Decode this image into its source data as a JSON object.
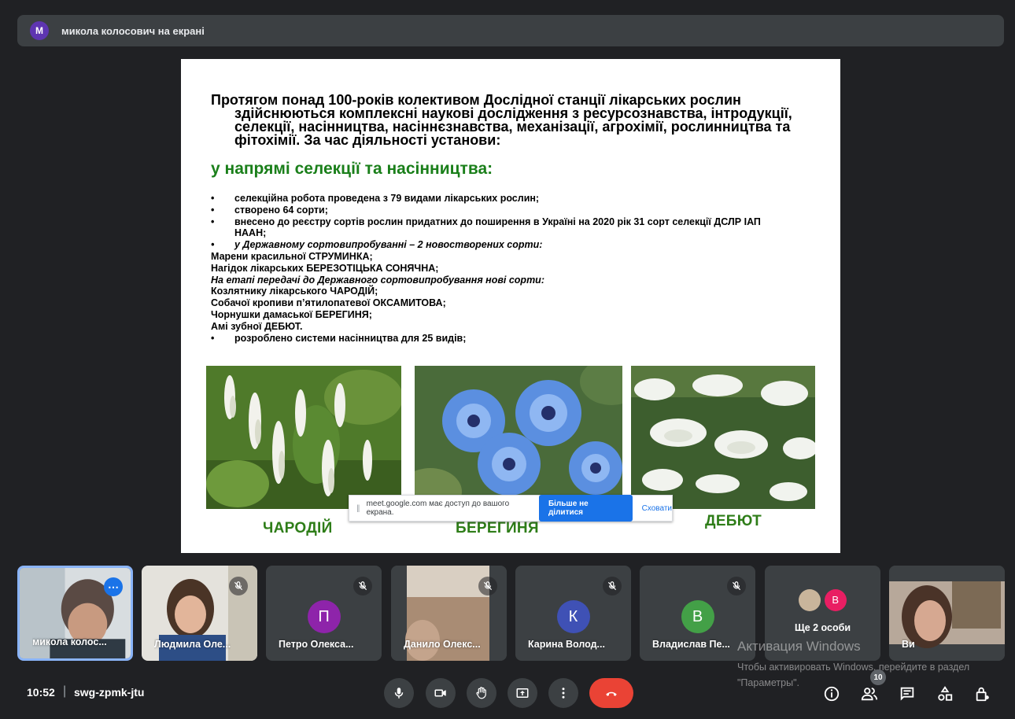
{
  "banner": {
    "avatar_letter": "М",
    "text": "микола колосович на екрані"
  },
  "slide": {
    "intro_line1": "Протягом понад 100-років колективом Дослідної станції лікарських рослин",
    "intro_rest": "здійснюються комплексні наукові дослідження з ресурсознавства, інтродукції, селекції, насінництва, насіннєзнавства, механізації, агрохімії, рослинництва та фітохімії. За час діяльності установи:",
    "heading": "у напрямі селекції та насінництва:",
    "lines": [
      "селекційна робота проведена з 79 видами лікарських рослин;",
      "створено 64 сорти;",
      "внесено до реєстру сортів рослин придатних до поширення в Україні на 2020 рік 31 сорт селекції ДСЛР ІАП НААН;",
      "у Державному сортовипробуванні – 2 новостворених сорти:",
      "Марени красильної СТРУМИНКА;",
      "Нагідок лікарських БЕРЕЗОТІЦЬКА СОНЯЧНА;",
      "На етапі передачі до Державного сортовипробування нові сорти:",
      "Козлятнику лікарського ЧАРОДІЙ;",
      "Собачої кропиви п’ятилопатевої ОКСАМИТОВА;",
      "Чорнушки дамаської БЕРЕГИНЯ;",
      "Амі зубної ДЕБЮТ.",
      "розроблено системи насінництва для 25 видів;"
    ],
    "captions": [
      "ЧАРОДІЙ",
      "БЕРЕГИНЯ",
      "ДЕБЮТ"
    ]
  },
  "sharebar": {
    "message": "meet.google.com має доступ до вашого екрана.",
    "stop_label": "Більше не ділитися",
    "hide_label": "Сховати"
  },
  "participants": [
    {
      "name": "микола колос...",
      "type": "video",
      "active": true
    },
    {
      "name": "Людмила Оле...",
      "type": "video",
      "muted": true
    },
    {
      "name": "Петро Олекса...",
      "type": "avatar",
      "letter": "П",
      "color": "#8e24aa",
      "muted": true
    },
    {
      "name": "Данило Олекс...",
      "type": "video",
      "muted": true
    },
    {
      "name": "Карина Волод...",
      "type": "avatar",
      "letter": "К",
      "color": "#3f51b5",
      "muted": true
    },
    {
      "name": "Владислав Пе...",
      "type": "avatar",
      "letter": "В",
      "color": "#43a047",
      "muted": true
    },
    {
      "name": "Ще 2 особи",
      "type": "others",
      "letter": "В",
      "color": "#e91e63"
    },
    {
      "name": "Ви",
      "type": "video"
    }
  ],
  "bottom": {
    "time": "10:52",
    "separator": "|",
    "meeting_code": "swg-zpmk-jtu",
    "participant_count": "10"
  },
  "watermark": {
    "title": "Активация Windows",
    "text": "Чтобы активировать Windows, перейдите в раздел \"Параметры\"."
  },
  "colors": {
    "background": "#202124",
    "tile": "#3c4043",
    "accent": "#1a73e8",
    "end_call": "#ea4335",
    "slide_heading": "#1a7f1a"
  }
}
